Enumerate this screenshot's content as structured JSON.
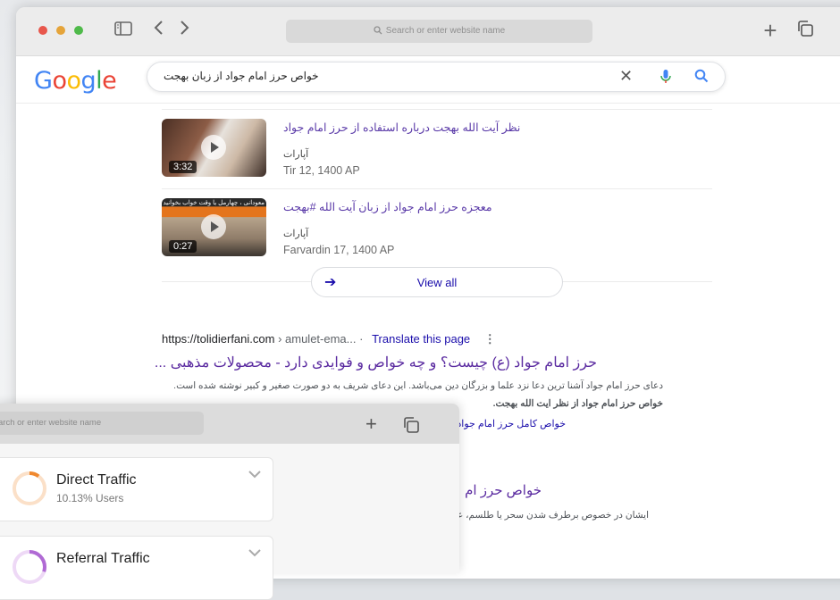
{
  "browser": {
    "url_placeholder": "Search or enter website name"
  },
  "google": {
    "logo": "Google",
    "query": "خواص حرز امام جواد از زبان بهجت"
  },
  "videos": [
    {
      "title": "نظر آیت الله بهجت درباره استفاده از حرز امام جواد",
      "source": "آپارات",
      "date": "Tir 12, 1400 AP",
      "duration": "3:32"
    },
    {
      "title": "معجزه حرز امام جواد از زبان آیت الله #بهجت",
      "source": "آپارات",
      "date": "Farvardin 17, 1400 AP",
      "duration": "0:27",
      "overlay_text": "معودانی ، چهارمل یا وقت خواب بخوانید"
    }
  ],
  "view_all": "View all",
  "result1": {
    "site": "https://tolidierfani.com",
    "path": "› amulet-ema...",
    "translate": "Translate this page",
    "title": "حرز امام جواد (ع) چیست؟ و چه خواص و فوایدی دارد - محصولات مذهبی ...",
    "snippet1": "دعای حرز امام جواد آشنا ترین دعا نزد علما و بزرگان دین می‌باشد. این دعای شریف به دو صورت صغیر و کبیر نوشته شده است.",
    "snippet2": "خواص حرز امام جواد از نظر ایت الله بهجت.",
    "sublink": "خواص کامل حرز امام جواد (ع"
  },
  "result2": {
    "title": "خواص حرز ام",
    "snippet": "ایشان در خصوص برطرف شدن سحر یا طلسم، علاو"
  },
  "front_window": {
    "url_placeholder": "arch or enter website name",
    "cards": [
      {
        "title": "Direct Traffic",
        "sub": "10.13% Users",
        "color": "#f0882e",
        "percent": 0.1013
      },
      {
        "title": "Referral Traffic",
        "sub": "",
        "color": "#b06ad4",
        "percent": 0.3
      }
    ]
  }
}
